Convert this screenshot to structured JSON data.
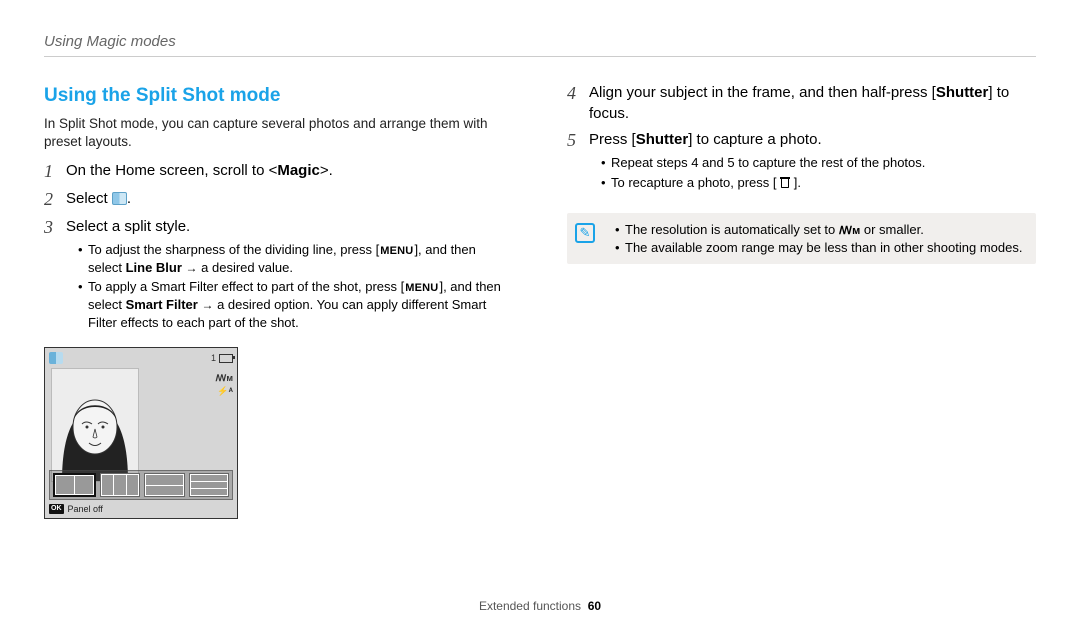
{
  "header": {
    "breadcrumb": "Using Magic modes"
  },
  "section": {
    "title": "Using the Split Shot mode",
    "intro": "In Split Shot mode, you can capture several photos and arrange them with preset layouts.",
    "steps_left": [
      {
        "n": "1",
        "text_pre": "On the Home screen, scroll to <",
        "bold": "Magic",
        "text_post": ">."
      },
      {
        "n": "2",
        "text_pre": "Select ",
        "icon": "split-shot-mode-icon",
        "text_post": "."
      },
      {
        "n": "3",
        "text_pre": "Select a split style.",
        "bullets": [
          {
            "parts": [
              "To adjust the sharpness of the dividing line, press [",
              {
                "menu": "MENU"
              },
              "], and then select ",
              {
                "b": "Line Blur"
              },
              " ",
              {
                "arrow": "→"
              },
              " a desired value."
            ]
          },
          {
            "parts": [
              "To apply a Smart Filter effect to part of the shot, press [",
              {
                "menu": "MENU"
              },
              "], and then select ",
              {
                "b": "Smart Filter"
              },
              " ",
              {
                "arrow": "→"
              },
              " a desired option. You can apply different Smart Filter effects to each part of the shot."
            ]
          }
        ]
      }
    ],
    "steps_right": [
      {
        "n": "4",
        "parts": [
          "Align your subject in the frame, and then half-press [",
          {
            "b": "Shutter"
          },
          "] to focus."
        ]
      },
      {
        "n": "5",
        "parts": [
          "Press [",
          {
            "b": "Shutter"
          },
          "] to capture a photo."
        ],
        "bullets": [
          {
            "parts": [
              "Repeat steps 4 and 5 to capture the rest of the photos."
            ]
          },
          {
            "parts": [
              "To recapture a photo, press [ ",
              {
                "trash": true
              },
              " ]."
            ]
          }
        ]
      }
    ],
    "tip": {
      "lines": [
        {
          "parts": [
            "The resolution is automatically set to ",
            {
              "res": "ꟿᴍ"
            },
            " or smaller."
          ]
        },
        {
          "parts": [
            "The available zoom range may be less than in other shooting modes."
          ]
        }
      ]
    }
  },
  "camera": {
    "top_right_count": "1",
    "side_ind1": "ꟿᴍ",
    "side_ind2": "⚡ᴬ",
    "bottom_ok": "OK",
    "bottom_label": "Panel off"
  },
  "footer": {
    "section": "Extended functions",
    "page": "60"
  }
}
